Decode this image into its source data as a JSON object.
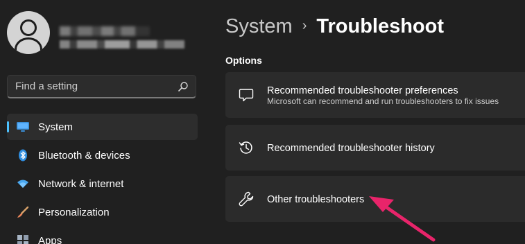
{
  "search": {
    "placeholder": "Find a setting"
  },
  "nav": {
    "items": [
      {
        "label": "System",
        "icon": "monitor-icon",
        "selected": true
      },
      {
        "label": "Bluetooth & devices",
        "icon": "bluetooth-icon"
      },
      {
        "label": "Network & internet",
        "icon": "wifi-icon"
      },
      {
        "label": "Personalization",
        "icon": "brush-icon"
      },
      {
        "label": "Apps",
        "icon": "apps-icon"
      }
    ]
  },
  "header": {
    "breadcrumb_parent": "System",
    "separator": "›",
    "current_page": "Troubleshoot"
  },
  "main": {
    "section_label": "Options",
    "cards": [
      {
        "title": "Recommended troubleshooter preferences",
        "description": "Microsoft can recommend and run troubleshooters to fix issues",
        "icon": "chat-bubble-icon"
      },
      {
        "title": "Recommended troubleshooter history",
        "icon": "history-icon"
      },
      {
        "title": "Other troubleshooters",
        "icon": "wrench-icon"
      }
    ]
  },
  "colors": {
    "background": "#202020",
    "card": "#2b2b2b",
    "accent": "#4cc2ff",
    "annotation_arrow": "#e8246a"
  }
}
